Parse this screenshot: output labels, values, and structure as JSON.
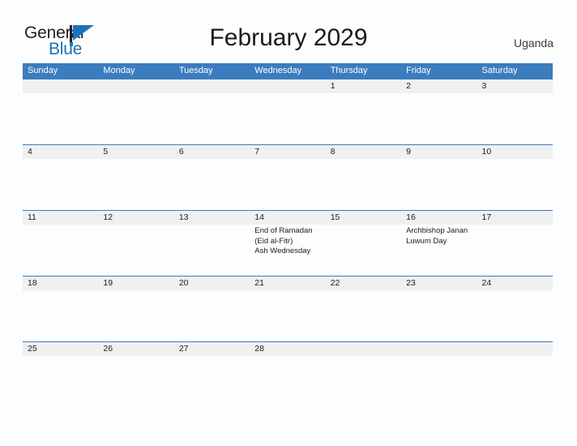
{
  "brand": {
    "word_one": "General",
    "word_two": "Blue",
    "logo_icon": "blue-triangle-flag-icon",
    "accent_color": "#1b74bb"
  },
  "header": {
    "title": "February 2029",
    "country": "Uganda"
  },
  "colors": {
    "header_blue": "#3b7cbf",
    "date_band_gray": "#f0f0f0",
    "page_background": "#fcfdfd",
    "text": "#1b1b1b"
  },
  "calendar": {
    "month": "February",
    "year": "2029",
    "weekdays": [
      "Sunday",
      "Monday",
      "Tuesday",
      "Wednesday",
      "Thursday",
      "Friday",
      "Saturday"
    ],
    "weeks": [
      {
        "days": [
          {
            "date": "",
            "events": ""
          },
          {
            "date": "",
            "events": ""
          },
          {
            "date": "",
            "events": ""
          },
          {
            "date": "",
            "events": ""
          },
          {
            "date": "1",
            "events": ""
          },
          {
            "date": "2",
            "events": ""
          },
          {
            "date": "3",
            "events": ""
          }
        ]
      },
      {
        "days": [
          {
            "date": "4",
            "events": ""
          },
          {
            "date": "5",
            "events": ""
          },
          {
            "date": "6",
            "events": ""
          },
          {
            "date": "7",
            "events": ""
          },
          {
            "date": "8",
            "events": ""
          },
          {
            "date": "9",
            "events": ""
          },
          {
            "date": "10",
            "events": ""
          }
        ]
      },
      {
        "days": [
          {
            "date": "11",
            "events": ""
          },
          {
            "date": "12",
            "events": ""
          },
          {
            "date": "13",
            "events": ""
          },
          {
            "date": "14",
            "events": "End of Ramadan\n(Eid al-Fitr)\n Ash Wednesday"
          },
          {
            "date": "15",
            "events": ""
          },
          {
            "date": "16",
            "events": "Archbishop Janan\nLuwum Day"
          },
          {
            "date": "17",
            "events": ""
          }
        ]
      },
      {
        "days": [
          {
            "date": "18",
            "events": ""
          },
          {
            "date": "19",
            "events": ""
          },
          {
            "date": "20",
            "events": ""
          },
          {
            "date": "21",
            "events": ""
          },
          {
            "date": "22",
            "events": ""
          },
          {
            "date": "23",
            "events": ""
          },
          {
            "date": "24",
            "events": ""
          }
        ]
      },
      {
        "days": [
          {
            "date": "25",
            "events": ""
          },
          {
            "date": "26",
            "events": ""
          },
          {
            "date": "27",
            "events": ""
          },
          {
            "date": "28",
            "events": ""
          },
          {
            "date": "",
            "events": ""
          },
          {
            "date": "",
            "events": ""
          },
          {
            "date": "",
            "events": ""
          }
        ]
      }
    ],
    "holidays": [
      {
        "date": "14",
        "name": "End of Ramadan (Eid al-Fitr)"
      },
      {
        "date": "14",
        "name": "Ash Wednesday"
      },
      {
        "date": "16",
        "name": "Archbishop Janan Luwum Day"
      }
    ]
  }
}
